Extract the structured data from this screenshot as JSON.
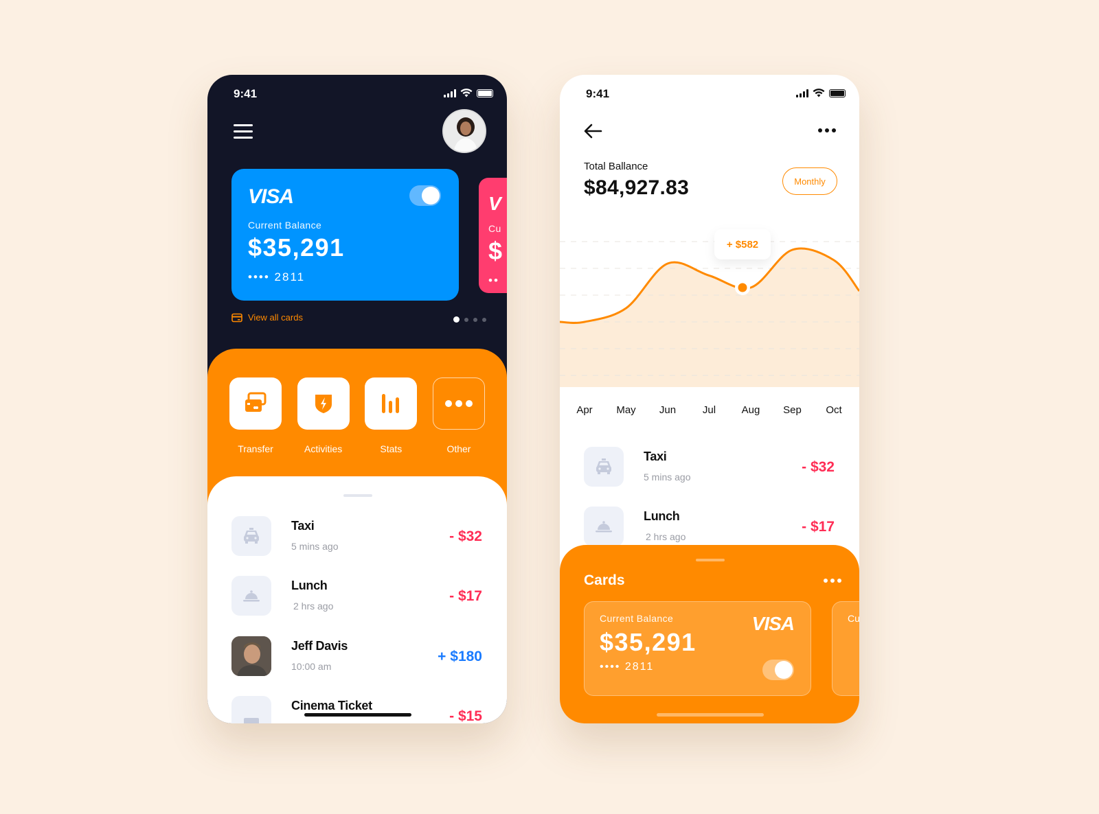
{
  "colors": {
    "accent": "#ff8a00",
    "dark": "#121527",
    "card_blue": "#0094ff",
    "card_pink": "#ff3d6f",
    "negative": "#ff2d55",
    "positive": "#1a7bff"
  },
  "wallet": {
    "status_time": "9:41",
    "card": {
      "brand": "VISA",
      "label": "Current Balance",
      "amount": "$35,291",
      "number": "•••• 2811",
      "enabled": true
    },
    "peek_card": {
      "brand": "V",
      "label": "Cu",
      "amount": "$",
      "number": "••"
    },
    "view_all": "View all cards",
    "pager": {
      "count": 4,
      "active": 0
    },
    "actions": [
      {
        "label": "Transfer",
        "icon": "cards-icon"
      },
      {
        "label": "Activities",
        "icon": "shield-bolt-icon"
      },
      {
        "label": "Stats",
        "icon": "bar-chart-icon"
      },
      {
        "label": "Other",
        "icon": "more-icon"
      }
    ],
    "transactions": [
      {
        "name": "Taxi",
        "time": "5 mins ago",
        "amount": "- $32",
        "type": "negative",
        "icon": "taxi-icon"
      },
      {
        "name": "Lunch",
        "time": "2 hrs ago",
        "amount": "- $17",
        "type": "negative",
        "icon": "cloche-icon"
      },
      {
        "name": "Jeff Davis",
        "time": "10:00 am",
        "amount": "+ $180",
        "type": "positive",
        "icon": "avatar"
      },
      {
        "name": "Cinema Ticket",
        "time": "",
        "amount": "- $15",
        "type": "negative",
        "icon": "ticket-icon"
      }
    ]
  },
  "stats": {
    "status_time": "9:41",
    "total_label": "Total Ballance",
    "total_amount": "$84,927.83",
    "period_button": "Monthly",
    "tooltip": "+ $582",
    "months": [
      "Apr",
      "May",
      "Jun",
      "Jul",
      "Aug",
      "Sep",
      "Oct"
    ],
    "transactions": [
      {
        "name": "Taxi",
        "time": "5 mins ago",
        "amount": "- $32",
        "type": "negative",
        "icon": "taxi-icon"
      },
      {
        "name": "Lunch",
        "time": "2 hrs ago",
        "amount": "- $17",
        "type": "negative",
        "icon": "cloche-icon"
      }
    ],
    "cards_panel": {
      "title": "Cards",
      "card": {
        "label": "Current Balance",
        "amount": "$35,291",
        "number": "•••• 2811",
        "brand": "VISA",
        "enabled": true
      },
      "peek_label": "Cu"
    }
  },
  "chart_data": {
    "type": "area",
    "title": "",
    "categories": [
      "Apr",
      "May",
      "Jun",
      "Jul",
      "Aug",
      "Sep",
      "Oct"
    ],
    "series": [
      {
        "name": "Balance",
        "values": [
          38,
          46,
          72,
          65,
          58,
          80,
          74
        ]
      }
    ],
    "highlight": {
      "category": "Aug",
      "label": "+ $582"
    },
    "ylim": [
      0,
      100
    ],
    "grid": true,
    "xlabel": "",
    "ylabel": ""
  }
}
